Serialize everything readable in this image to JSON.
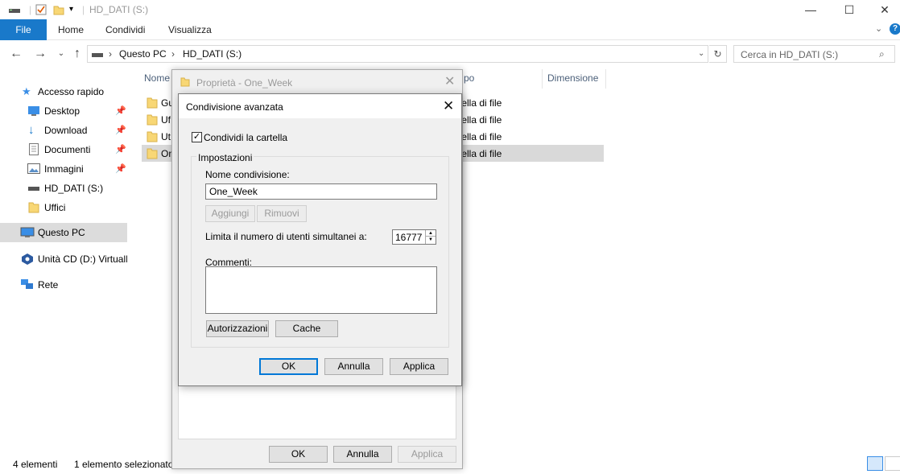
{
  "window": {
    "title": "HD_DATI (S:)",
    "controls": {
      "minimize": "—",
      "maximize": "☐",
      "close": "✕"
    }
  },
  "ribbon": {
    "tabs": [
      "File",
      "Home",
      "Condividi",
      "Visualizza"
    ],
    "help": "?"
  },
  "address": {
    "crumbs": [
      "Questo PC",
      "HD_DATI (S:)"
    ],
    "search_placeholder": "Cerca in HD_DATI (S:)"
  },
  "navpane": {
    "items": [
      {
        "label": "Accesso rapido",
        "icon": "star-icon"
      },
      {
        "label": "Desktop",
        "icon": "desktop-icon",
        "pinned": true
      },
      {
        "label": "Download",
        "icon": "download-arrow-icon",
        "pinned": true
      },
      {
        "label": "Documenti",
        "icon": "document-icon",
        "pinned": true
      },
      {
        "label": "Immagini",
        "icon": "pictures-icon",
        "pinned": true
      },
      {
        "label": "HD_DATI (S:)",
        "icon": "drive-icon"
      },
      {
        "label": "Uffici",
        "icon": "folder-icon"
      },
      {
        "label": "Questo PC",
        "icon": "computer-icon",
        "selected": true
      },
      {
        "label": "Unità CD (D:) VirtualB",
        "icon": "cd-drive-icon"
      },
      {
        "label": "Rete",
        "icon": "network-icon"
      }
    ]
  },
  "filelist": {
    "columns": [
      "Nome",
      "po",
      "Dimensione"
    ],
    "rows": [
      {
        "name": "Gu",
        "type": "rtella di file"
      },
      {
        "name": "Uf",
        "type": "rtella di file"
      },
      {
        "name": "Ut",
        "type": "rtella di file"
      },
      {
        "name": "On",
        "type": "rtella di file",
        "selected": true
      }
    ]
  },
  "status": {
    "count": "4 elementi",
    "selection": "1 elemento selezionato"
  },
  "properties_dialog": {
    "title": "Proprietà - One_Week",
    "ok": "OK",
    "cancel": "Annulla",
    "apply": "Applica"
  },
  "advanced_share": {
    "title": "Condivisione avanzata",
    "share_checkbox_label": "Condividi la cartella",
    "share_checked": true,
    "settings_group": "Impostazioni",
    "share_name_label": "Nome condivisione:",
    "share_name_value": "One_Week",
    "add_button": "Aggiungi",
    "remove_button": "Rimuovi",
    "limit_label": "Limita il numero di utenti simultanei a:",
    "limit_value": "16777",
    "comments_label": "Commenti:",
    "comments_value": "",
    "permissions_button": "Autorizzazioni",
    "cache_button": "Cache",
    "ok": "OK",
    "cancel": "Annulla",
    "apply": "Applica"
  },
  "colors": {
    "accent": "#1979ca",
    "selection": "#d9d9d9",
    "focus": "#0078d7"
  }
}
